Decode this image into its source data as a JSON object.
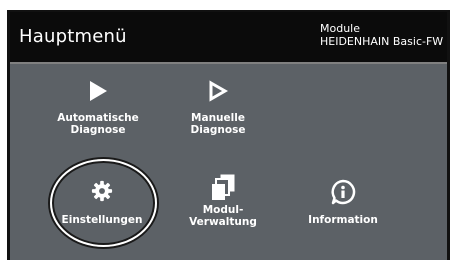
{
  "header": {
    "title": "Hauptmenü",
    "module_line1": "Module",
    "module_line2": "HEIDENHAIN Basic-FW"
  },
  "tiles": [
    {
      "label": "Automatische\nDiagnose",
      "icon": "play-filled-icon"
    },
    {
      "label": "Manuelle\nDiagnose",
      "icon": "play-outline-icon"
    },
    {
      "label": "Einstellungen",
      "icon": "gear-icon",
      "focused": true
    },
    {
      "label": "Modul-\nVerwaltung",
      "icon": "module-stack-icon"
    },
    {
      "label": "Information",
      "icon": "info-icon"
    }
  ],
  "colors": {
    "panel_bg": "#5c6166",
    "header_bg": "#0b0b0b",
    "text": "#ffffff"
  }
}
